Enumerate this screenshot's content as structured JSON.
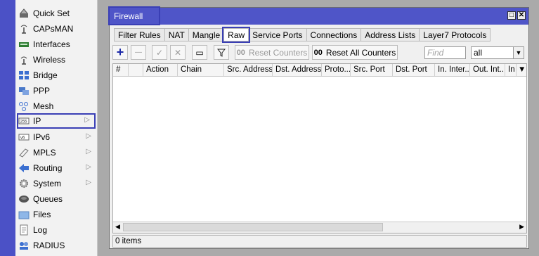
{
  "sidebar": {
    "items": [
      {
        "label": "Quick Set",
        "icon": "quick-set-icon"
      },
      {
        "label": "CAPsMAN",
        "icon": "capsman-icon"
      },
      {
        "label": "Interfaces",
        "icon": "interfaces-icon"
      },
      {
        "label": "Wireless",
        "icon": "wireless-icon"
      },
      {
        "label": "Bridge",
        "icon": "bridge-icon"
      },
      {
        "label": "PPP",
        "icon": "ppp-icon"
      },
      {
        "label": "Mesh",
        "icon": "mesh-icon"
      },
      {
        "label": "IP",
        "icon": "ip-icon",
        "selected": true,
        "submenu": true
      },
      {
        "label": "IPv6",
        "icon": "ipv6-icon",
        "submenu": true
      },
      {
        "label": "MPLS",
        "icon": "mpls-icon",
        "submenu": true
      },
      {
        "label": "Routing",
        "icon": "routing-icon",
        "submenu": true
      },
      {
        "label": "System",
        "icon": "system-icon",
        "submenu": true
      },
      {
        "label": "Queues",
        "icon": "queues-icon"
      },
      {
        "label": "Files",
        "icon": "files-icon"
      },
      {
        "label": "Log",
        "icon": "log-icon"
      },
      {
        "label": "RADIUS",
        "icon": "radius-icon"
      }
    ]
  },
  "window": {
    "title": "Firewall",
    "restore_glyph": "□",
    "close_glyph": "✕"
  },
  "tabs": [
    {
      "label": "Filter Rules"
    },
    {
      "label": "NAT"
    },
    {
      "label": "Mangle"
    },
    {
      "label": "Raw",
      "active": true
    },
    {
      "label": "Service Ports"
    },
    {
      "label": "Connections"
    },
    {
      "label": "Address Lists"
    },
    {
      "label": "Layer7 Protocols"
    }
  ],
  "toolbar": {
    "add_glyph": "+",
    "remove_glyph": "—",
    "enable_glyph": "✓",
    "disable_glyph": "✕",
    "comment_glyph": "▭",
    "filter_glyph": "▼",
    "reset_counters_label": "Reset Counters",
    "reset_counters_prefix": "00",
    "reset_all_counters_label": "Reset All Counters",
    "reset_all_counters_prefix": "00",
    "find_placeholder": "Find",
    "filter_value": "all"
  },
  "table": {
    "columns": [
      "#",
      "",
      "Action",
      "Chain",
      "Src. Address",
      "Dst. Address",
      "Proto...",
      "Src. Port",
      "Dst. Port",
      "In. Inter...",
      "Out. Int...",
      "In"
    ],
    "rows": []
  },
  "status": {
    "text": "0 items"
  },
  "colors": {
    "brand": "#4b51c6",
    "titlebar": "#4f55c8",
    "highlight": "#3a3fb5",
    "add_icon": "#1d2aa8"
  }
}
